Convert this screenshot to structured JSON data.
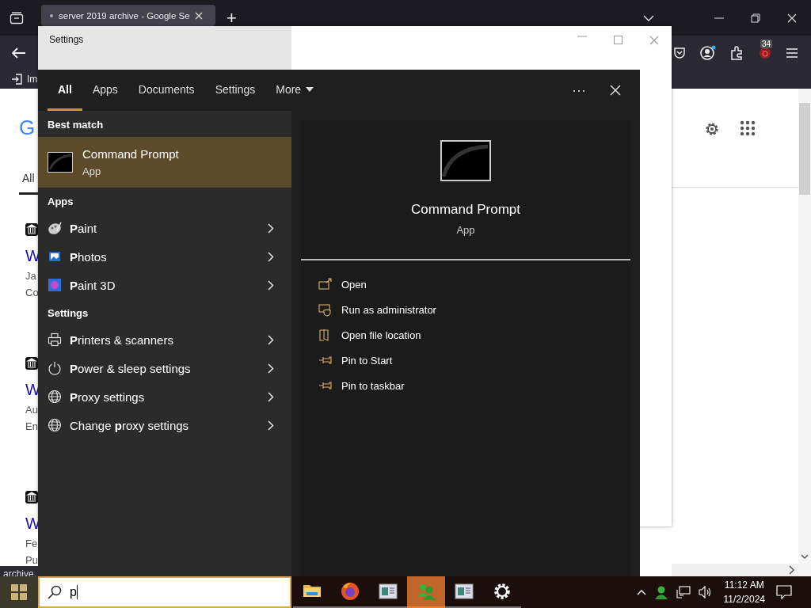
{
  "browser": {
    "tab_title": "server 2019 archive - Google Se",
    "new_tab": "+",
    "bookmark": "Im",
    "addon_badge": "34",
    "page": {
      "logo": "G",
      "tab": "All",
      "results": [
        {
          "title": "W",
          "line_1": "Ja",
          "line_2": "Co"
        },
        {
          "title": "W",
          "line_1": "Au",
          "line_2": "En"
        },
        {
          "title": "W",
          "line_1": "Fe",
          "line_2": "Pu"
        }
      ],
      "status": "archive."
    }
  },
  "settings_window": {
    "title": "Settings"
  },
  "search": {
    "tabs": [
      {
        "label": "All",
        "selected": true
      },
      {
        "label": "Apps",
        "selected": false
      },
      {
        "label": "Documents",
        "selected": false
      },
      {
        "label": "Settings",
        "selected": false
      },
      {
        "label": "More",
        "selected": false
      }
    ],
    "more_menu": "⋯",
    "best_match": {
      "heading": "Best match",
      "name": "Command Prompt",
      "type": "App",
      "selected": true
    },
    "sections": [
      {
        "heading": "Apps",
        "items": [
          {
            "name": "**P**aint"
          },
          {
            "name": "**P**hotos"
          },
          {
            "name": "**P**aint 3D"
          }
        ]
      },
      {
        "heading": "Settings",
        "items": [
          {
            "name": "**P**rinters & scanners"
          },
          {
            "name": "**P**ower & sleep settings"
          },
          {
            "name": "**P**roxy settings"
          },
          {
            "name": "Change **p**roxy settings"
          }
        ]
      }
    ],
    "preview": {
      "name": "Command Prompt",
      "type": "App",
      "actions": [
        {
          "label": "Open"
        },
        {
          "label": "Run as administrator"
        },
        {
          "label": "Open file location"
        },
        {
          "label": "Pin to Start"
        },
        {
          "label": "Pin to taskbar"
        }
      ]
    },
    "query": "p"
  },
  "taskbar": {
    "apps": [
      {
        "selected": false
      },
      {
        "selected": false
      },
      {
        "selected": false
      },
      {
        "selected": true
      },
      {
        "selected": false
      },
      {
        "selected": false
      }
    ],
    "time": "11:12 AM",
    "date": "11/2/2024"
  }
}
